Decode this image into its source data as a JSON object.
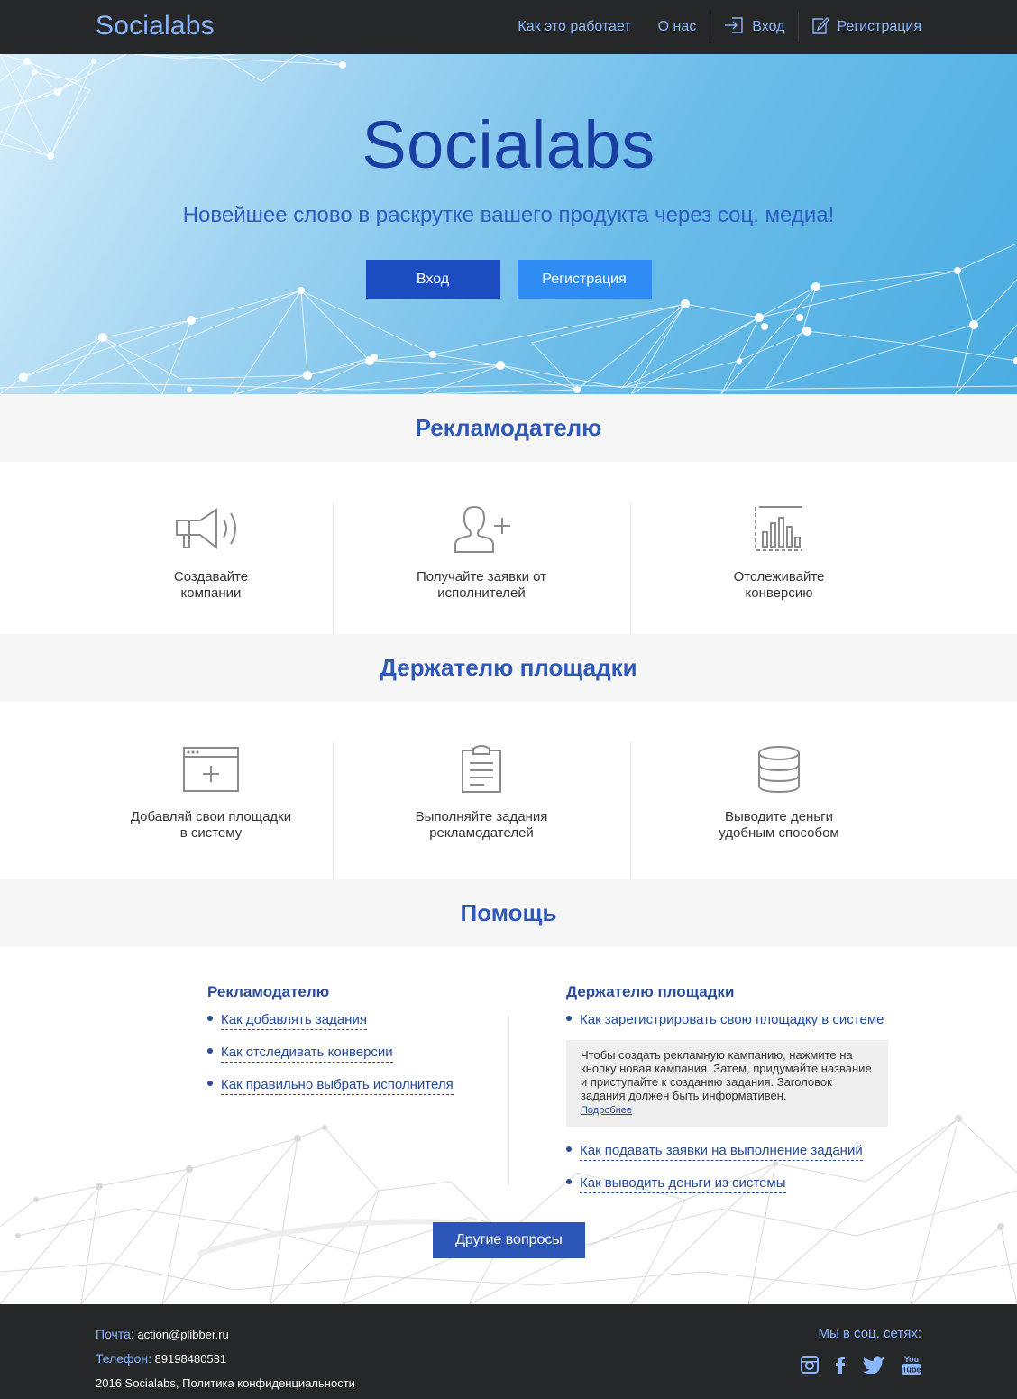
{
  "header": {
    "logo": "Socialabs",
    "nav": {
      "how": "Как это работает",
      "about": "О нас",
      "login": "Вход",
      "register": "Регистрация"
    }
  },
  "hero": {
    "title": "Socialabs",
    "subtitle": "Новейшее слово в раскрутке вашего продукта через соц. медиа!",
    "login_button": "Вход",
    "register_button": "Регистрация"
  },
  "advertiser": {
    "title": "Рекламодателю",
    "items": [
      {
        "label": "Создавайте\nкомпании",
        "icon": "megaphone-icon"
      },
      {
        "label": "Получайте заявки от\nисполнителей",
        "icon": "add-user-icon"
      },
      {
        "label": "Отслеживайте\nконверсию",
        "icon": "bar-chart-icon"
      }
    ]
  },
  "owner": {
    "title": "Держателю площадки",
    "items": [
      {
        "label": "Добавляй свои площадки\nв систему",
        "icon": "add-window-icon"
      },
      {
        "label": "Выполняйте задания\nрекламодателей",
        "icon": "clipboard-icon"
      },
      {
        "label": "Выводите деньги\nудобным способом",
        "icon": "coins-icon"
      }
    ]
  },
  "help": {
    "title": "Помощь",
    "left": {
      "heading": "Рекламодателю",
      "links": [
        "Как добавлять задания",
        "Как отследивать конверсии",
        "Как правильно выбрать исполнителя"
      ]
    },
    "right": {
      "heading": "Держателю площадки",
      "links": [
        "Как зарегистрировать свою площадку в системе",
        "Как подавать заявки на выполнение заданий",
        "Как выводить деньги из системы"
      ],
      "expanded_text": "Чтобы создать рекламную кампанию, нажмите на кнопку новая кампания. Затем, придумайте название и приступайте к созданию задания. Заголовок задания должен быть информативен.",
      "more_link": "Подробнее"
    },
    "button": "Другие вопросы"
  },
  "footer": {
    "mail_label": "Почта:",
    "mail": "action@plibber.ru",
    "phone_label": "Телефон:",
    "phone": "89198480531",
    "copyright": "2016 Socialabs, Политика конфиденциальности",
    "social_title": "Мы в соц. сетях:",
    "social_icons": [
      "instagram-icon",
      "facebook-icon",
      "twitter-icon",
      "youtube-icon"
    ],
    "youtube_text_top": "You",
    "youtube_text_bottom": "Tube"
  },
  "colors": {
    "topbar": "#252728",
    "accent": "#8ab6ff",
    "heading": "#2e59b8",
    "button_dark": "#1b4dc0",
    "button_light": "#2f8cf3"
  }
}
